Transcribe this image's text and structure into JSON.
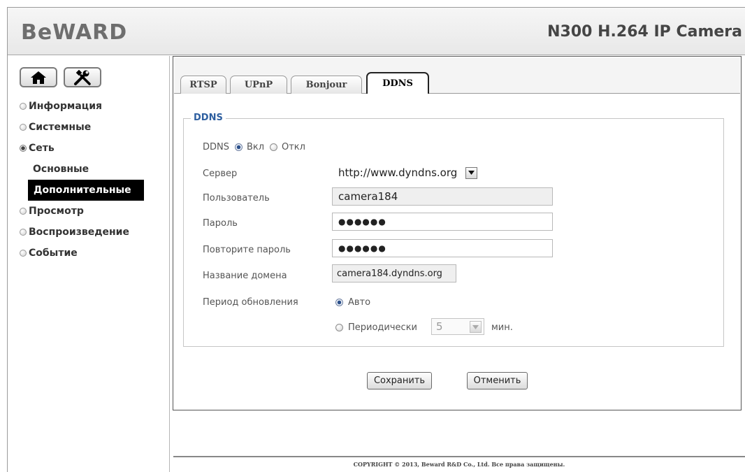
{
  "header": {
    "logo": "BeWARD",
    "product_title": "N300 H.264 IP Camera"
  },
  "sidebar": {
    "home_icon": "home-icon",
    "tools_icon": "tools-icon",
    "items": [
      {
        "label": "Информация",
        "selected": false
      },
      {
        "label": "Системные",
        "selected": false
      },
      {
        "label": "Сеть",
        "selected": true
      },
      {
        "label": "Просмотр",
        "selected": false
      },
      {
        "label": "Воспроизведение",
        "selected": false
      },
      {
        "label": "Событие",
        "selected": false
      }
    ],
    "subitems": [
      {
        "label": "Основные",
        "active": false
      },
      {
        "label": "Дополнительные",
        "active": true
      }
    ]
  },
  "tabs": [
    {
      "label": "RTSP",
      "active": false
    },
    {
      "label": "UPnP",
      "active": false
    },
    {
      "label": "Bonjour",
      "active": false
    },
    {
      "label": "DDNS",
      "active": true
    }
  ],
  "ddns": {
    "legend": "DDNS",
    "enable_label": "DDNS",
    "on_label": "Вкл",
    "off_label": "Откл",
    "enabled": true,
    "server_label": "Сервер",
    "server_value": "http://www.dyndns.org",
    "user_label": "Пользователь",
    "user_value": "camera184",
    "password_label": "Пароль",
    "password_value": "●●●●●●",
    "repeat_password_label": "Повторите пароль",
    "repeat_password_value": "●●●●●●",
    "domain_label": "Название домена",
    "domain_value": "camera184.dyndns.org",
    "period_label": "Период обновления",
    "auto_label": "Авто",
    "auto_selected": true,
    "periodic_label": "Периодически",
    "periodic_value": "5",
    "periodic_unit": "мин."
  },
  "buttons": {
    "save": "Сохранить",
    "cancel": "Отменить"
  },
  "footer": {
    "copyright": "COPYRIGHT © 2013, Beward R&D Co., Ltd. Все права защищены."
  },
  "colors": {
    "legend": "#2e5fa0",
    "active_menu_bg": "#000000",
    "active_menu_text": "#ffffff"
  }
}
